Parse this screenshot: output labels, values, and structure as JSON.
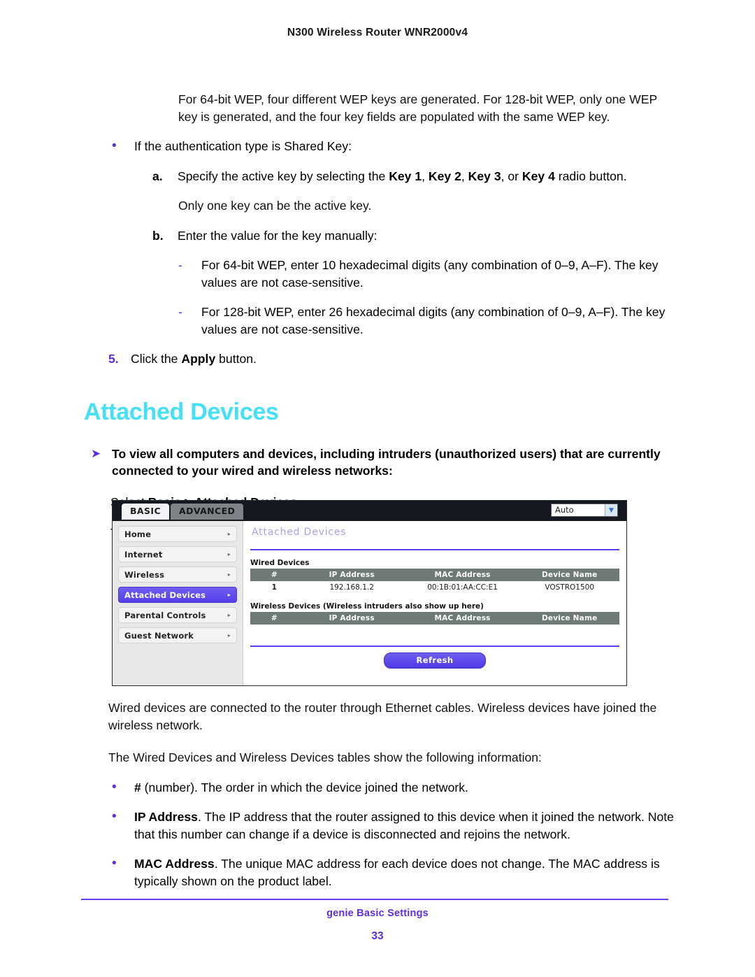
{
  "header": {
    "title": "N300 Wireless Router WNR2000v4"
  },
  "intro": {
    "wep_paragraph": "For 64-bit WEP, four different WEP keys are generated. For 128-bit WEP, only one WEP key is generated, and the four key fields are populated with the same WEP key.",
    "shared_key_bullet": "If the authentication type is Shared Key:",
    "bullet_marker": "•"
  },
  "steps": {
    "a": {
      "marker": "a.",
      "text_before": "Specify the active key by selecting the ",
      "key1": "Key 1",
      "sep1": ", ",
      "key2": "Key 2",
      "sep2": ", ",
      "key3": "Key 3",
      "sep3": ", or ",
      "key4": "Key 4",
      "text_after": " radio button.",
      "note": "Only one key can be the active key."
    },
    "b": {
      "marker": "b.",
      "text": "Enter the value for the key manually:",
      "dash_marker": "-",
      "dash1": "For 64-bit WEP, enter 10 hexadecimal digits (any combination of 0–9, A–F). The key values are not case-sensitive.",
      "dash2": "For 128-bit WEP, enter 26 hexadecimal digits (any combination of 0–9, A–F). The key values are not case-sensitive."
    },
    "five": {
      "marker": "5.",
      "text_before": "Click the ",
      "bold": "Apply",
      "text_after": " button."
    }
  },
  "section": {
    "heading": "Attached Devices",
    "arrow_marker": "➤",
    "procedure": "To view all computers and devices, including intruders (unauthorized users) that are currently connected to your wired and wireless networks:",
    "select_prefix": "Select ",
    "select_path": "Basic > Attached Devices",
    "select_suffix": ".",
    "displays": "The Attached Devices screen displays:"
  },
  "router_ui": {
    "tabs": [
      {
        "label": "BASIC",
        "active": true
      },
      {
        "label": "ADVANCED",
        "active": false
      }
    ],
    "language_select": {
      "value": "Auto",
      "caret": "▼"
    },
    "sidebar": [
      {
        "label": "Home",
        "selected": false,
        "arrow": "▸"
      },
      {
        "label": "Internet",
        "selected": false,
        "arrow": "▸"
      },
      {
        "label": "Wireless",
        "selected": false,
        "arrow": "▸"
      },
      {
        "label": "Attached Devices",
        "selected": true,
        "arrow": "▸"
      },
      {
        "label": "Parental Controls",
        "selected": false,
        "arrow": "▸"
      },
      {
        "label": "Guest Network",
        "selected": false,
        "arrow": "▸"
      }
    ],
    "panel_title": "Attached Devices",
    "wired": {
      "caption": "Wired Devices",
      "columns": [
        "#",
        "IP Address",
        "MAC Address",
        "Device Name"
      ],
      "rows": [
        [
          "1",
          "192.168.1.2",
          "00:1B:01:AA:CC:E1",
          "VOSTRO1500"
        ]
      ]
    },
    "wireless": {
      "caption": "Wireless Devices (Wireless intruders also show up here)",
      "columns": [
        "#",
        "IP Address",
        "MAC Address",
        "Device Name"
      ],
      "rows": []
    },
    "refresh_label": "Refresh"
  },
  "lower": {
    "p1": "Wired devices are connected to the router through Ethernet cables. Wireless devices have joined the wireless network.",
    "p2": "The Wired Devices and Wireless Devices tables show the following information:",
    "bullet_marker": "•",
    "b1_bold": "#",
    "b1_rest": " (number). The order in which the device joined the network.",
    "b2_bold": "IP Address",
    "b2_rest": ". The IP address that the router assigned to this device when it joined the network. Note that this number can change if a device is disconnected and rejoins the network.",
    "b3_bold": "MAC Address",
    "b3_rest": ". The unique MAC address for each device does not change. The MAC address is typically shown on the product label."
  },
  "footer": {
    "title": "genie Basic Settings",
    "page": "33"
  },
  "colors": {
    "accent_purple": "#5b2ee0",
    "heading_cyan": "#45e0f5",
    "table_header_gray": "#6f7a78",
    "selected_nav": "#5440e8"
  }
}
